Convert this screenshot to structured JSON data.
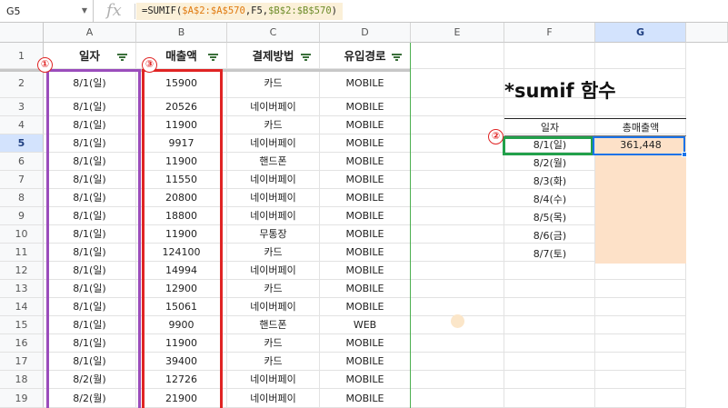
{
  "formula_bar": {
    "cell_ref": "G5",
    "fx_label": "fx",
    "formula_prefix": "=SUMIF(",
    "formula_range1": "$A$2:$A$570",
    "formula_mid": ",F5,",
    "formula_range2": "$B$2:$B$570",
    "formula_suffix": ")"
  },
  "columns": [
    "A",
    "B",
    "C",
    "D",
    "E",
    "F",
    "G"
  ],
  "rows": [
    "1",
    "2",
    "3",
    "4",
    "5",
    "6",
    "7",
    "8",
    "9",
    "10",
    "11",
    "12",
    "13",
    "14",
    "15",
    "16",
    "17",
    "18",
    "19"
  ],
  "table_headers": [
    "일자",
    "매출액",
    "결제방법",
    "유입경로"
  ],
  "table_rows": [
    [
      "8/1(일)",
      "15900",
      "카드",
      "MOBILE"
    ],
    [
      "8/1(일)",
      "20526",
      "네이버페이",
      "MOBILE"
    ],
    [
      "8/1(일)",
      "11900",
      "카드",
      "MOBILE"
    ],
    [
      "8/1(일)",
      "9917",
      "네이버페이",
      "MOBILE"
    ],
    [
      "8/1(일)",
      "11900",
      "핸드폰",
      "MOBILE"
    ],
    [
      "8/1(일)",
      "11550",
      "네이버페이",
      "MOBILE"
    ],
    [
      "8/1(일)",
      "20800",
      "네이버페이",
      "MOBILE"
    ],
    [
      "8/1(일)",
      "18800",
      "네이버페이",
      "MOBILE"
    ],
    [
      "8/1(일)",
      "11900",
      "무통장",
      "MOBILE"
    ],
    [
      "8/1(일)",
      "124100",
      "카드",
      "MOBILE"
    ],
    [
      "8/1(일)",
      "14994",
      "네이버페이",
      "MOBILE"
    ],
    [
      "8/1(일)",
      "12900",
      "카드",
      "MOBILE"
    ],
    [
      "8/1(일)",
      "15061",
      "네이버페이",
      "MOBILE"
    ],
    [
      "8/1(일)",
      "9900",
      "핸드폰",
      "WEB"
    ],
    [
      "8/1(일)",
      "11900",
      "카드",
      "MOBILE"
    ],
    [
      "8/1(일)",
      "39400",
      "카드",
      "MOBILE"
    ],
    [
      "8/2(월)",
      "12726",
      "네이버페이",
      "MOBILE"
    ],
    [
      "8/2(월)",
      "21900",
      "네이버페이",
      "MOBILE"
    ]
  ],
  "summary": {
    "title": "*sumif 함수",
    "headers": [
      "일자",
      "총매출액"
    ],
    "dates": [
      "8/1(일)",
      "8/2(월)",
      "8/3(화)",
      "8/4(수)",
      "8/5(목)",
      "8/6(금)",
      "8/7(토)"
    ],
    "result": "361,448"
  },
  "markers": [
    "①",
    "②",
    "③"
  ],
  "colors": {
    "purple_box": "#9b4dbc",
    "red_box": "#e02424",
    "green_box": "#22a04b",
    "selection_blue": "#1a73e8",
    "peach_fill": "#fde1c8"
  }
}
